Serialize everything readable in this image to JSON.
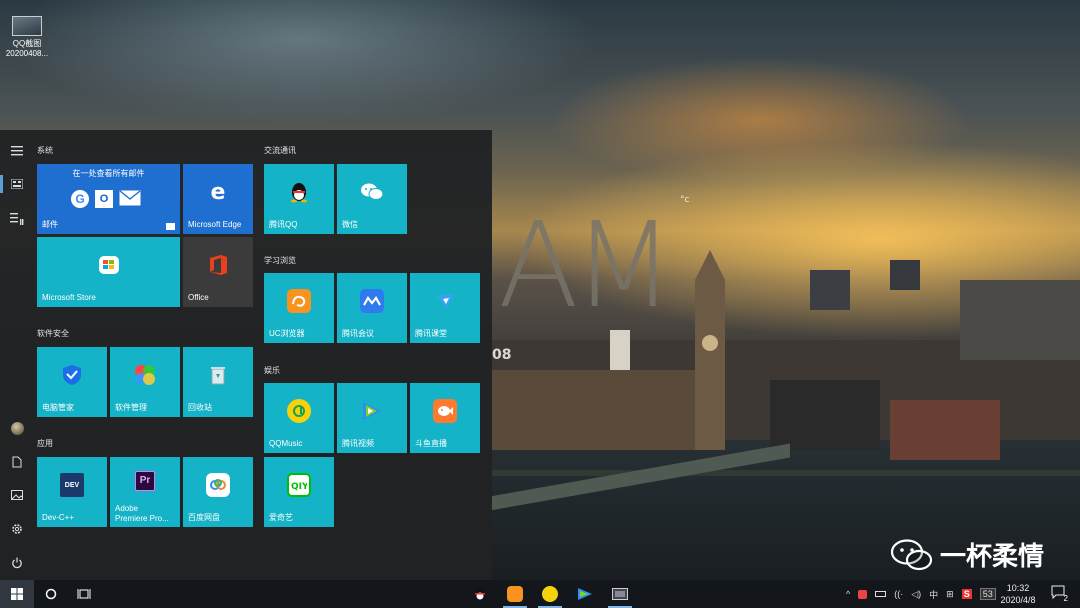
{
  "desktop": {
    "icon_label_line1": "QQ截图",
    "icon_label_line2": "20200408..."
  },
  "wallpaper": {
    "clock_text": "AM",
    "temp_unit": "°c",
    "date_fragment": "08"
  },
  "start_menu": {
    "groups": {
      "system": "系统",
      "communication": "交流通讯",
      "learning": "学习浏览",
      "security": "软件安全",
      "entertainment": "娱乐",
      "apps": "应用"
    },
    "tiles": {
      "mail_header": "在一处查看所有邮件",
      "mail": "邮件",
      "edge": "Microsoft Edge",
      "store": "Microsoft Store",
      "office": "Office",
      "qq": "腾讯QQ",
      "wechat": "微信",
      "uc": "UC浏览器",
      "tencent_meeting": "腾讯会议",
      "tencent_classroom": "腾讯课堂",
      "pc_manager": "电脑管家",
      "software_manager": "软件管理",
      "recycle_bin": "回收站",
      "qqmusic": "QQMusic",
      "tencent_video": "腾讯视频",
      "douyu": "斗鱼直播",
      "iqiyi": "爱奇艺",
      "devcpp": "Dev-C++",
      "premiere_line1": "Adobe",
      "premiere_line2": "Premiere Pro...",
      "baidu": "百度网盘"
    },
    "icons": {
      "edge_glyph": "e",
      "devcpp_glyph": "DEV",
      "premiere_glyph": "Pr"
    }
  },
  "taskbar": {
    "tray_ime": "中",
    "tray_s": "S",
    "tray_53": "53",
    "time": "10:32",
    "date": "2020/4/8",
    "notifications": "2"
  },
  "watermark": {
    "text": "一杯柔情"
  },
  "colors": {
    "tile": "#14b3c7",
    "mail_tile": "#1e6fd0",
    "office_tile": "#3b3b3b",
    "menu_bg": "#202224"
  }
}
